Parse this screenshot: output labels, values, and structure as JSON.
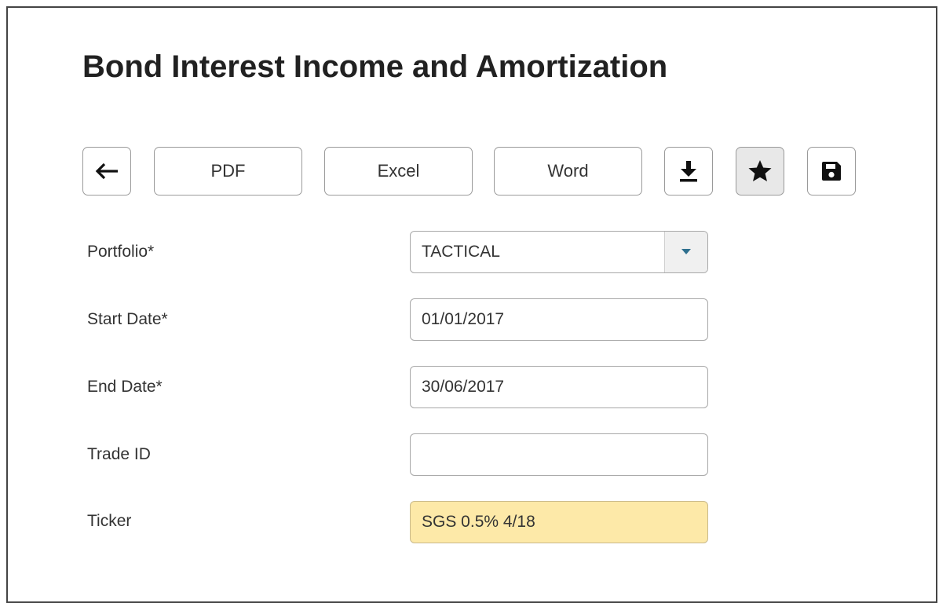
{
  "page": {
    "title": "Bond Interest Income and Amortization"
  },
  "toolbar": {
    "back_icon": "arrow-left-icon",
    "pdf_label": "PDF",
    "excel_label": "Excel",
    "word_label": "Word",
    "download_icon": "download-icon",
    "favorite_icon": "star-icon",
    "save_icon": "floppy-disk-icon"
  },
  "form": {
    "portfolio": {
      "label": "Portfolio*",
      "value": "TACTICAL"
    },
    "start_date": {
      "label": "Start Date*",
      "value": "01/01/2017"
    },
    "end_date": {
      "label": "End Date*",
      "value": "30/06/2017"
    },
    "trade_id": {
      "label": "Trade ID",
      "value": ""
    },
    "ticker": {
      "label": "Ticker",
      "value": "SGS 0.5% 4/18",
      "highlight_color": "#fde9a8"
    }
  },
  "colors": {
    "dropdown_arrow": "#2e6f8e"
  }
}
